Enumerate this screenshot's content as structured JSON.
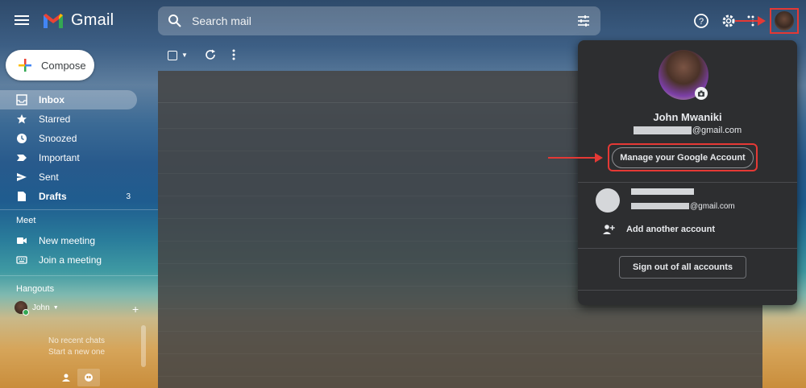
{
  "app": {
    "name": "Gmail"
  },
  "search": {
    "placeholder": "Search mail"
  },
  "compose": {
    "label": "Compose"
  },
  "sidebar": {
    "items": [
      {
        "label": "Inbox",
        "icon": "inbox-icon"
      },
      {
        "label": "Starred",
        "icon": "star-icon"
      },
      {
        "label": "Snoozed",
        "icon": "clock-icon"
      },
      {
        "label": "Important",
        "icon": "important-icon"
      },
      {
        "label": "Sent",
        "icon": "send-icon"
      },
      {
        "label": "Drafts",
        "icon": "draft-icon",
        "count": "3"
      }
    ],
    "meet_title": "Meet",
    "meet_items": [
      {
        "label": "New meeting",
        "icon": "video-icon"
      },
      {
        "label": "Join a meeting",
        "icon": "keyboard-icon"
      }
    ],
    "hangouts_title": "Hangouts",
    "hangouts_user": "John",
    "no_chats": "No recent chats",
    "start_chat": "Start a new one"
  },
  "account_panel": {
    "name": "John Mwaniki",
    "email_suffix": "@gmail.com",
    "manage_label": "Manage your Google Account",
    "other_email_suffix": "@gmail.com",
    "add_account_label": "Add another account",
    "signout_label": "Sign out of all accounts"
  },
  "colors": {
    "highlight": "#e53935",
    "panel_bg": "#2d2e30"
  }
}
